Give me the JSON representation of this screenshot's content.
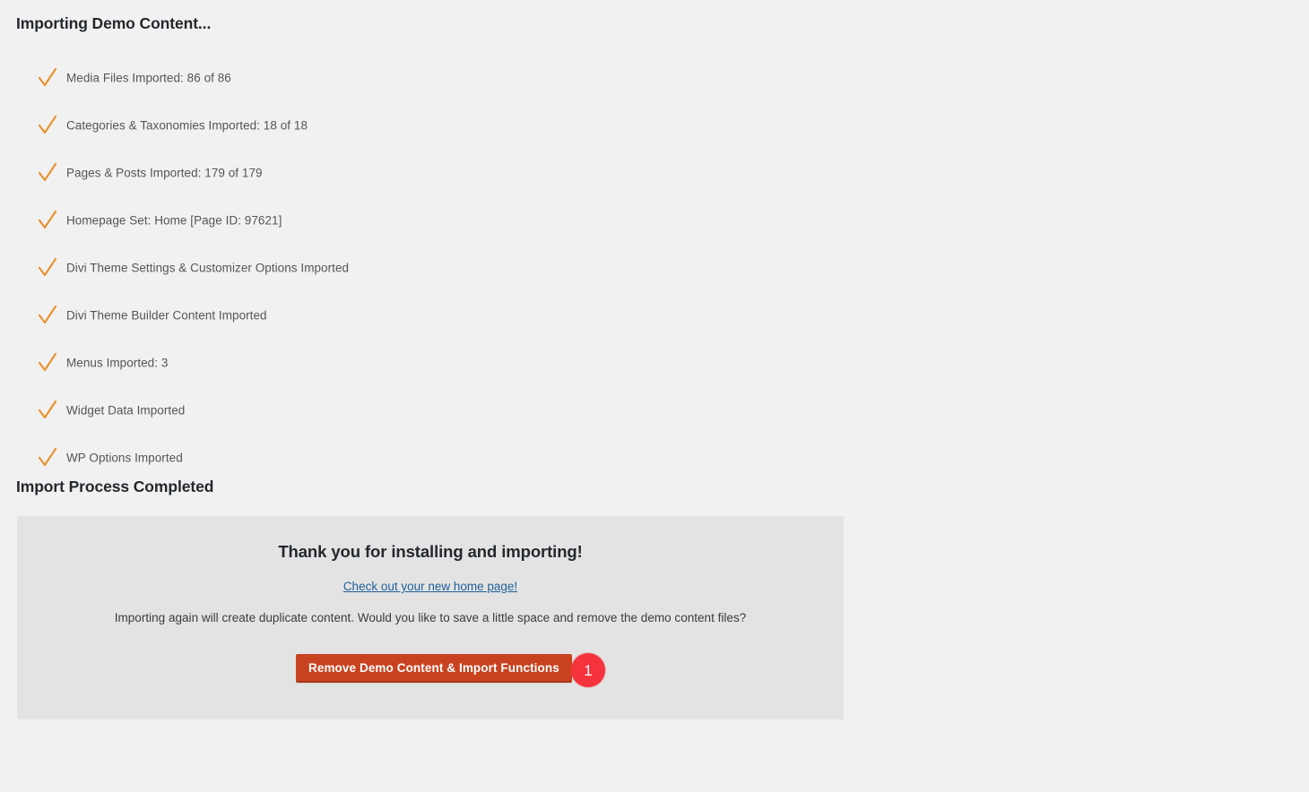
{
  "page": {
    "title": "Importing Demo Content...",
    "section_title": "Import Process Completed",
    "background_color": "#f1f1f1"
  },
  "progress": {
    "check_icon": "check-icon",
    "check_color": "#e8902a",
    "items": [
      {
        "label": "Media Files Imported: 86 of 86"
      },
      {
        "label": "Categories & Taxonomies Imported: 18 of 18"
      },
      {
        "label": "Pages & Posts Imported: 179 of 179"
      },
      {
        "label": "Homepage Set: Home [Page ID: 97621]"
      },
      {
        "label": "Divi Theme Settings & Customizer Options Imported"
      },
      {
        "label": "Divi Theme Builder Content Imported"
      },
      {
        "label": "Menus Imported: 3"
      },
      {
        "label": "Widget Data Imported"
      },
      {
        "label": "WP Options Imported"
      }
    ]
  },
  "completion_panel": {
    "background_color": "#e3e3e3",
    "heading": "Thank you for installing and importing!",
    "link_text": "Check out your new home page!",
    "link_color": "#21609b",
    "description": "Importing again will create duplicate content. Would you like to save a little space and remove the demo content files?",
    "remove_button_label": "Remove Demo Content & Import Functions",
    "remove_button_color": "#c9421f",
    "step_badge_number": "1",
    "step_badge_color": "#f4333d"
  }
}
